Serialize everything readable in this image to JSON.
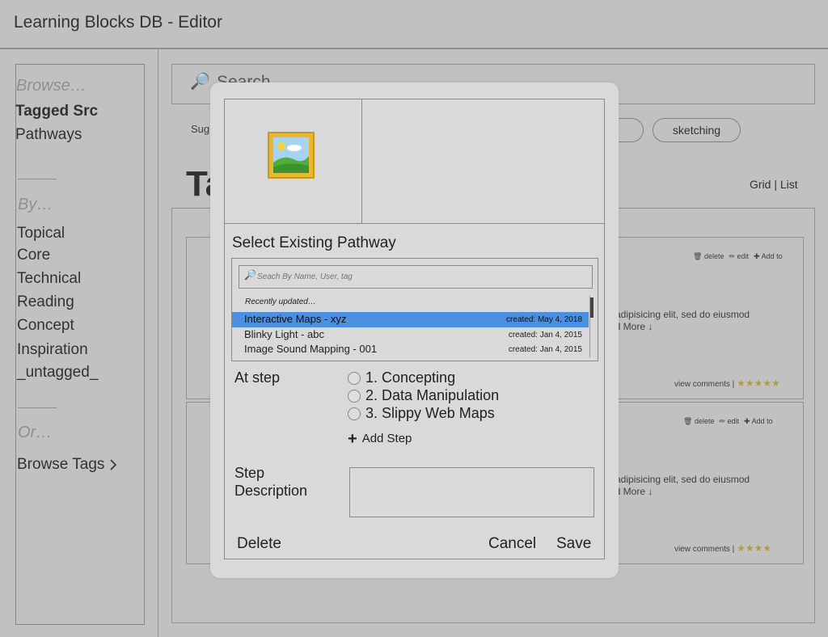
{
  "app": {
    "title": "Learning Blocks DB - Editor"
  },
  "sidebar": {
    "browse_label": "Browse…",
    "browse_items": [
      "Tagged Src",
      "Pathways"
    ],
    "by_label": "By…",
    "by_items": [
      "Topical",
      "Core",
      "Technical",
      "Reading",
      "Concept",
      "Inspiration",
      "_untagged_"
    ],
    "or_label": "Or…",
    "browse_tags": "Browse Tags"
  },
  "search": {
    "placeholder": "Search"
  },
  "suggest": {
    "label": "Sug",
    "tags": [
      "",
      "sketching"
    ]
  },
  "main": {
    "heading": "Ta",
    "view_toggle": "Grid | List"
  },
  "cards": [
    {
      "actions": {
        "delete": "delete",
        "edit": "edit",
        "add": "Add to"
      },
      "text": "adipisicing elit, sed do eiusmod",
      "more": "ad More ↓",
      "foot": "view comments |",
      "stars": "★★★★★"
    },
    {
      "actions": {
        "delete": "delete",
        "edit": "edit",
        "add": "Add to"
      },
      "text": "adipisicing elit, sed do eiusmod",
      "more": "ad More ↓",
      "foot": "view comments |",
      "stars": "★★★★"
    }
  ],
  "modal": {
    "select_title": "Select Existing Pathway",
    "search_placeholder": "Seach By Name, User, tag",
    "recent_label": "Recently updated…",
    "pathways": [
      {
        "name": "Interactive Maps - xyz",
        "created": "created: May 4, 2018",
        "selected": true
      },
      {
        "name": "Blinky Light - abc",
        "created": "created: Jan 4, 2015",
        "selected": false
      },
      {
        "name": "Image Sound Mapping - 001",
        "created": "created: Jan 4, 2015",
        "selected": false
      }
    ],
    "at_step_label": "At step",
    "steps": [
      "1. Concepting",
      "2. Data Manipulation",
      "3. Slippy Web Maps"
    ],
    "add_step": "Add Step",
    "step_desc_label_1": "Step",
    "step_desc_label_2": "Description",
    "delete": "Delete",
    "cancel": "Cancel",
    "save": "Save"
  },
  "colors": {
    "selected_row": "#4a8fe0",
    "background": "#d9d9d9"
  },
  "icons": {
    "search": "magnifier-icon",
    "image": "framed-picture-icon",
    "add": "plus-icon"
  }
}
